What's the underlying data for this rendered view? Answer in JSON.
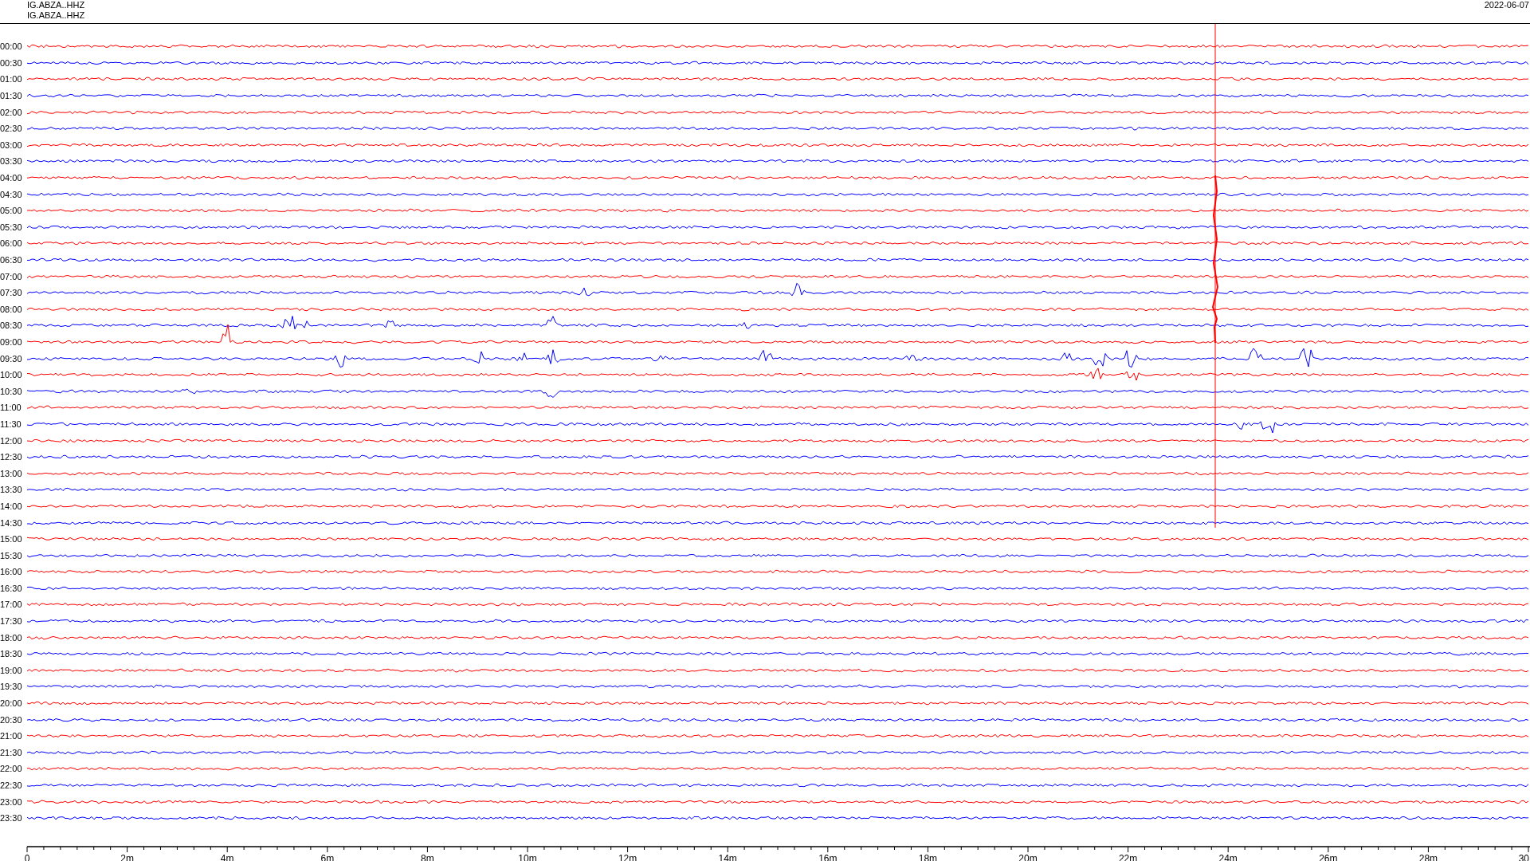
{
  "header": {
    "station_lines": [
      "IG.ABZA..HHZ",
      "IG.ABZA..HHZ"
    ],
    "date": "2022-06-07"
  },
  "rows": [
    {
      "time": "00:00",
      "color": "#ff0000"
    },
    {
      "time": "00:30",
      "color": "#0000ff"
    },
    {
      "time": "01:00",
      "color": "#ff0000"
    },
    {
      "time": "01:30",
      "color": "#0000ff"
    },
    {
      "time": "02:00",
      "color": "#ff0000"
    },
    {
      "time": "02:30",
      "color": "#0000ff"
    },
    {
      "time": "03:00",
      "color": "#ff0000"
    },
    {
      "time": "03:30",
      "color": "#0000ff"
    },
    {
      "time": "04:00",
      "color": "#ff0000"
    },
    {
      "time": "04:30",
      "color": "#0000ff"
    },
    {
      "time": "05:00",
      "color": "#ff0000"
    },
    {
      "time": "05:30",
      "color": "#0000ff"
    },
    {
      "time": "06:00",
      "color": "#ff0000"
    },
    {
      "time": "06:30",
      "color": "#0000ff"
    },
    {
      "time": "07:00",
      "color": "#ff0000"
    },
    {
      "time": "07:30",
      "color": "#0000ff"
    },
    {
      "time": "08:00",
      "color": "#ff0000"
    },
    {
      "time": "08:30",
      "color": "#0000ff"
    },
    {
      "time": "09:00",
      "color": "#ff0000"
    },
    {
      "time": "09:30",
      "color": "#0000ff"
    },
    {
      "time": "10:00",
      "color": "#ff0000"
    },
    {
      "time": "10:30",
      "color": "#0000ff"
    },
    {
      "time": "11:00",
      "color": "#ff0000"
    },
    {
      "time": "11:30",
      "color": "#0000ff"
    },
    {
      "time": "12:00",
      "color": "#ff0000"
    },
    {
      "time": "12:30",
      "color": "#0000ff"
    },
    {
      "time": "13:00",
      "color": "#ff0000"
    },
    {
      "time": "13:30",
      "color": "#0000ff"
    },
    {
      "time": "14:00",
      "color": "#ff0000"
    },
    {
      "time": "14:30",
      "color": "#0000ff"
    },
    {
      "time": "15:00",
      "color": "#ff0000"
    },
    {
      "time": "15:30",
      "color": "#0000ff"
    },
    {
      "time": "16:00",
      "color": "#ff0000"
    },
    {
      "time": "16:30",
      "color": "#0000ff"
    },
    {
      "time": "17:00",
      "color": "#ff0000"
    },
    {
      "time": "17:30",
      "color": "#0000ff"
    },
    {
      "time": "18:00",
      "color": "#ff0000"
    },
    {
      "time": "18:30",
      "color": "#0000ff"
    },
    {
      "time": "19:00",
      "color": "#ff0000"
    },
    {
      "time": "19:30",
      "color": "#0000ff"
    },
    {
      "time": "20:00",
      "color": "#ff0000"
    },
    {
      "time": "20:30",
      "color": "#0000ff"
    },
    {
      "time": "21:00",
      "color": "#ff0000"
    },
    {
      "time": "21:30",
      "color": "#0000ff"
    },
    {
      "time": "22:00",
      "color": "#ff0000"
    },
    {
      "time": "22:30",
      "color": "#0000ff"
    },
    {
      "time": "23:00",
      "color": "#ff0000"
    },
    {
      "time": "23:30",
      "color": "#0000ff"
    }
  ],
  "x_axis": {
    "ticks": [
      "0",
      "2m",
      "4m",
      "6m",
      "8m",
      "10m",
      "12m",
      "14m",
      "16m",
      "18m",
      "20m",
      "22m",
      "24m",
      "26m",
      "28m",
      "30"
    ]
  }
}
